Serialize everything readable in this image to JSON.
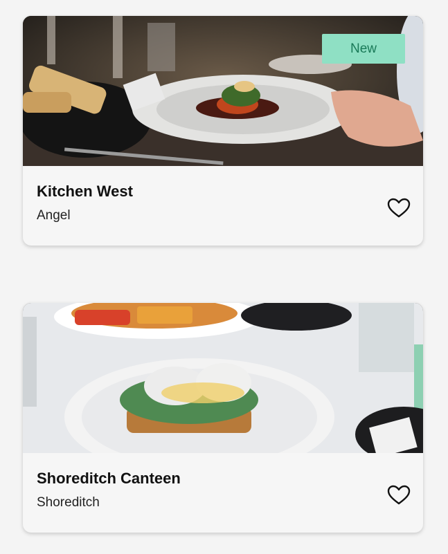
{
  "restaurants": [
    {
      "name": "Kitchen West",
      "area": "Angel",
      "badge": "New",
      "favorite_icon": "heart-outline-icon"
    },
    {
      "name": "Shoreditch Canteen",
      "area": "Shoreditch",
      "favorite_icon": "heart-outline-icon"
    }
  ],
  "colors": {
    "badge_bg": "#8fe0c4",
    "badge_text": "#1a7a58",
    "card_bg": "#f6f6f6"
  }
}
